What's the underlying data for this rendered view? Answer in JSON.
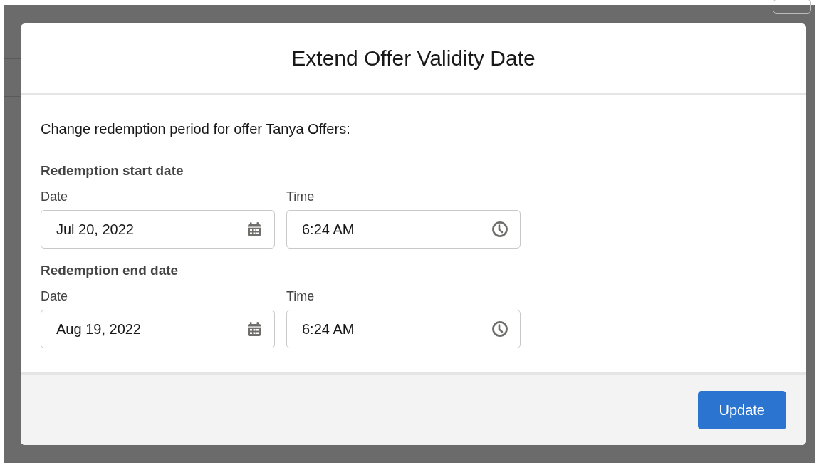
{
  "dialog": {
    "title": "Extend Offer Validity Date",
    "intro": "Change redemption period for offer Tanya Offers:",
    "sections": [
      {
        "label": "Redemption start date",
        "date_label": "Date",
        "date": "Jul 20, 2022",
        "time_label": "Time",
        "time": "6:24 AM"
      },
      {
        "label": "Redemption end date",
        "date_label": "Date",
        "date": "Aug 19, 2022",
        "time_label": "Time",
        "time": "6:24 AM"
      }
    ],
    "buttons": [
      {
        "label": "Update",
        "kind": "primary"
      }
    ]
  }
}
